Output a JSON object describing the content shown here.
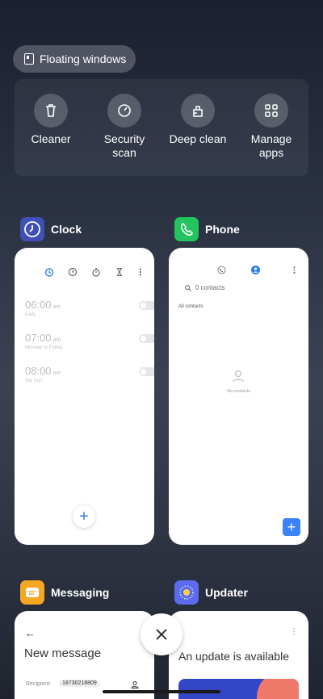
{
  "floating": {
    "label": "Floating windows",
    "icon": "floating-window-icon"
  },
  "tools": [
    {
      "label": "Cleaner",
      "icon": "trash-icon"
    },
    {
      "label": "Security\nscan",
      "icon": "security-gauge-icon"
    },
    {
      "label": "Deep clean",
      "icon": "deep-clean-icon"
    },
    {
      "label": "Manage\napps",
      "icon": "grid-apps-icon"
    }
  ],
  "apps": {
    "clock": {
      "name": "Clock",
      "icon_color": "#3f51b5",
      "tabs": [
        "alarm-icon",
        "world-clock-icon",
        "stopwatch-icon",
        "timer-icon",
        "more-icon"
      ],
      "alarms": [
        {
          "time": "06:00",
          "ampm": "am",
          "repeat": "Daily"
        },
        {
          "time": "07:00",
          "ampm": "am",
          "repeat": "Monday to Friday"
        },
        {
          "time": "08:00",
          "ampm": "am",
          "repeat": "Sat Sun"
        }
      ],
      "add": "+"
    },
    "phone": {
      "name": "Phone",
      "icon_color": "#23c45e",
      "search_placeholder": "0 contacts",
      "section": "All contacts",
      "empty": "No contacts",
      "add": "+"
    },
    "messaging": {
      "name": "Messaging",
      "icon_color": "#f5a623",
      "back": "←",
      "title": "New message",
      "recipient_label": "Recipient:",
      "recipient_value": "18730218809"
    },
    "updater": {
      "name": "Updater",
      "icon_color": "#5b6cf0",
      "more": "⋮",
      "title": "An update is available"
    }
  },
  "close": "×"
}
